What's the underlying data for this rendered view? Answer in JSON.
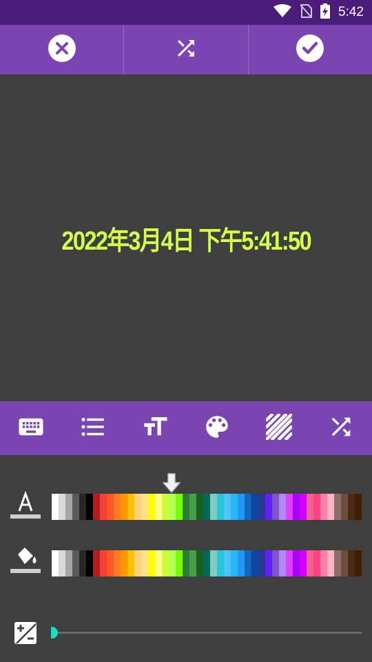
{
  "status_bar": {
    "time": "5:42",
    "icons": [
      "wifi-icon",
      "no-sim-icon",
      "battery-charging-icon"
    ]
  },
  "top_toolbar": {
    "buttons": [
      "close-icon",
      "shuffle-icon",
      "check-icon"
    ]
  },
  "preview": {
    "text": "2022年3月4日 下午5:41:50",
    "color": "#d4ff4a"
  },
  "tool_bar": {
    "icons": [
      "keyboard-icon",
      "list-icon",
      "text-size-icon",
      "palette-icon",
      "stripes-icon",
      "shuffle-icon"
    ]
  },
  "text_color_row": {
    "icon": "text-color-icon",
    "selected_color": "#ccff33"
  },
  "background_color_row": {
    "icon": "fill-color-icon"
  },
  "brightness_row": {
    "icon": "exposure-icon",
    "value": 0
  },
  "colors": {
    "accent_dark": "#4a1d7a",
    "accent": "#7a45b0",
    "slider": "#1ed8c3",
    "palette": [
      "#ffffff",
      "#d9d9d9",
      "#a6a6a6",
      "#595959",
      "#262626",
      "#000000",
      "#b71c1c",
      "#f44336",
      "#ff5722",
      "#ff7b25",
      "#ff9800",
      "#ffc107",
      "#ffd180",
      "#ffe082",
      "#ffff00",
      "#ffff8d",
      "#ccff33",
      "#b2ff59",
      "#76ff03",
      "#2e7d32",
      "#43a047",
      "#1b5e20",
      "#00695c",
      "#80cbc4",
      "#26c6da",
      "#4fc3f7",
      "#29b6f6",
      "#2196f3",
      "#1565c0",
      "#0d47a1",
      "#283593",
      "#651fff",
      "#7e57c2",
      "#b388ff",
      "#e040fb",
      "#aa00ff",
      "#d500f9",
      "#f06292",
      "#ff4081",
      "#ff80ab",
      "#ffb4c8",
      "#8d6e63",
      "#6d4c41",
      "#4e2a0e",
      "#3e1f08"
    ]
  }
}
